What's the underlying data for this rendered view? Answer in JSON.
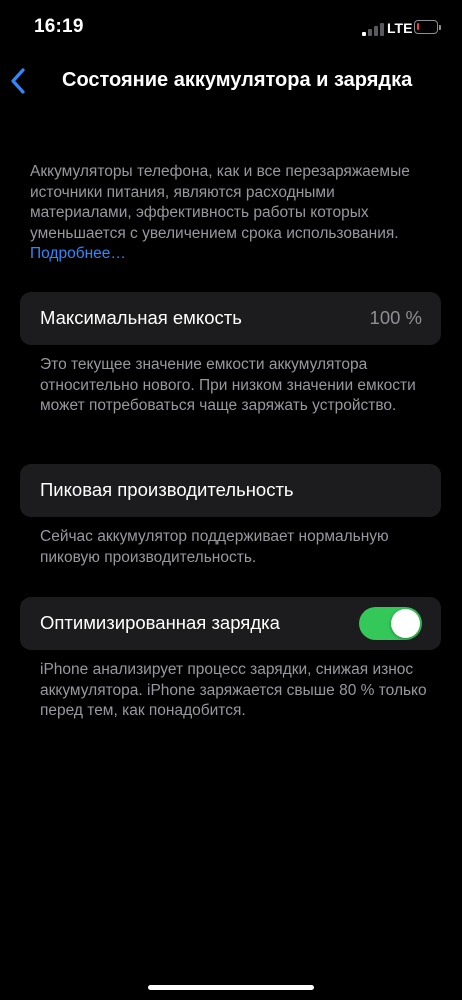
{
  "status_bar": {
    "time": "16:19",
    "network": "LTE",
    "signal_bars_active": 1,
    "signal_bars_total": 4,
    "battery_level": 0.08,
    "battery_color": "#ff3b30"
  },
  "nav": {
    "back_icon": "chevron-left-icon",
    "title": "Состояние аккумулятора и зарядка"
  },
  "intro": {
    "text": "Аккумуляторы телефона, как и все перезаряжаемые источники питания, являются расходными материалами, эффективность работы которых уменьшается с увеличением срока использования.",
    "link": "Подробнее…"
  },
  "max_capacity": {
    "label": "Максимальная емкость",
    "value": "100 %",
    "footnote": "Это текущее значение емкости аккумулятора относительно нового. При низком значении емкости может потребоваться чаще заряжать устройство."
  },
  "peak_performance": {
    "label": "Пиковая производительность",
    "footnote": "Сейчас аккумулятор поддерживает нормальную пиковую производительность."
  },
  "optimized_charging": {
    "label": "Оптимизированная зарядка",
    "enabled": true,
    "toggle_color": "#34c759",
    "footnote": "iPhone анализирует процесс зарядки, снижая износ аккумулятора. iPhone заряжается свыше 80 % только перед тем, как понадобится."
  },
  "colors": {
    "accent": "#2f89fc",
    "background": "#000000",
    "card": "#1c1c1e",
    "secondary_text": "#98989d"
  }
}
